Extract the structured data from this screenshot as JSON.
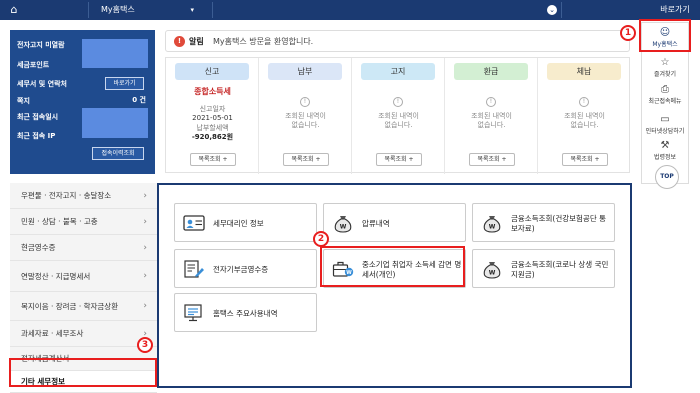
{
  "topbar": {
    "home_icon": "home-icon",
    "menu_select": "My홈택스",
    "dropdown_icon": "chevron-down-icon",
    "quick_link": "바로가기"
  },
  "user_panel": {
    "rows": [
      {
        "label": "전자고지 미열람"
      },
      {
        "label": "세금포인트"
      },
      {
        "label": "세무서 및 연락처",
        "button": "바로가기"
      },
      {
        "label": "쪽지",
        "value": "0 건"
      },
      {
        "label": "최근 접속일시"
      },
      {
        "label": "최근 접속 IP"
      }
    ],
    "history_button": "접속이력조회"
  },
  "notice": {
    "label": "알림",
    "text": "My홈택스 방문을 환영합니다."
  },
  "status_cards": [
    {
      "title": "신고",
      "color": "#cfe3f7",
      "item": "종합소득세",
      "date_label": "신고일자",
      "date": "2021-05-01",
      "amount_label": "납부할세액",
      "amount": "-920,862원",
      "button": "목록조회 +"
    },
    {
      "title": "납부",
      "color": "#dbe6f7",
      "empty_text": "조회된 내역이",
      "empty_text2": "없습니다.",
      "button": "목록조회 +"
    },
    {
      "title": "고지",
      "color": "#cde8f6",
      "empty_text": "조회된 내역이",
      "empty_text2": "없습니다.",
      "button": "목록조회 +"
    },
    {
      "title": "환급",
      "color": "#d3efd3",
      "empty_text": "조회된 내역이",
      "empty_text2": "없습니다.",
      "button": "목록조회 +"
    },
    {
      "title": "체납",
      "color": "#f7eccd",
      "empty_text": "조회된 내역이",
      "empty_text2": "없습니다.",
      "button": "목록조회 +"
    }
  ],
  "right_menu": {
    "items": [
      {
        "label": "My홈택스",
        "icon": "person-icon"
      },
      {
        "label": "즐겨찾기",
        "icon": "star-icon"
      },
      {
        "label": "최근접속메뉴",
        "icon": "recent-icon"
      },
      {
        "label": "인터넷상담하기",
        "icon": "chat-icon"
      },
      {
        "label": "법령정보",
        "icon": "gavel-icon"
      }
    ],
    "collapse": "접기 ^",
    "top_button": "TOP"
  },
  "left_menu": [
    {
      "label": "우편물 · 전자고지 · 송달장소",
      "arrow": "›"
    },
    {
      "label": "민원 · 상담 · 불복 · 고충",
      "arrow": "›"
    },
    {
      "label": "현금영수증",
      "arrow": "›"
    },
    {
      "label": "연말정산 · 지급명세서",
      "arrow": "›"
    },
    {
      "label": "복지이음 · 장려금 · 학자금상환",
      "arrow": "›"
    },
    {
      "label": "과세자료 · 세무조사",
      "arrow": "›"
    },
    {
      "label": "전자세금계산서",
      "arrow": ""
    },
    {
      "label": "기타 세무정보",
      "arrow": ""
    }
  ],
  "tiles": [
    {
      "label": "세무대리인 정보",
      "icon": "id-card-icon"
    },
    {
      "label": "압류내역",
      "icon": "money-bag-icon"
    },
    {
      "label": "금융소득조회(건강보험공단 통보자료)",
      "icon": "money-bag-icon"
    },
    {
      "label": "전자기부금영수증",
      "icon": "receipt-pen-icon"
    },
    {
      "label": "중소기업 취업자 소득세 감면 명세서(개인)",
      "icon": "briefcase-money-icon"
    },
    {
      "label": "금융소득조회(코로나 상생 국민지원금)",
      "icon": "money-bag-icon"
    },
    {
      "label": "홈택스 주요사용내역",
      "icon": "monitor-list-icon"
    }
  ],
  "callouts": [
    "1",
    "2",
    "3"
  ],
  "colors": {
    "accent": "#1b3a72",
    "highlight": "#e81e1e"
  }
}
